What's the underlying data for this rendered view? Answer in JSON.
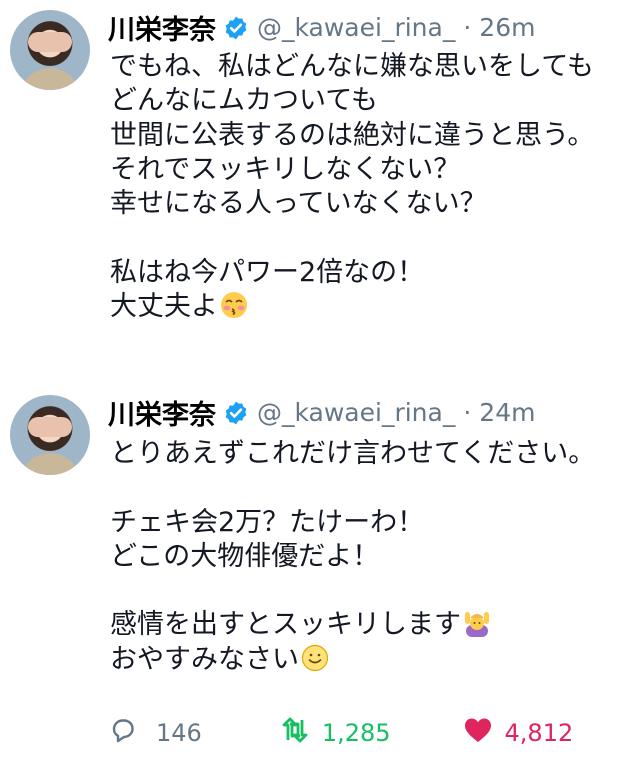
{
  "tweets": [
    {
      "name": "川栄李奈",
      "handle": "@_kawaei_rina_",
      "separator": "·",
      "time": "26m",
      "lines": [
        "でもね、私はどんなに嫌な思いをしても",
        "どんなにムカついても",
        "世間に公表するのは絶対に違うと思う。",
        "それでスッキリしなくない？",
        "幸せになる人っていなくない？",
        "",
        "私はね今パワー2倍なの！",
        "大丈夫よ"
      ],
      "emoji": "kissing-face-icon"
    },
    {
      "name": "川栄李奈",
      "handle": "@_kawaei_rina_",
      "separator": "·",
      "time": "24m",
      "lines": [
        "とりあえずこれだけ言わせてください。",
        "",
        "チェキ会2万？たけーわ！",
        "どこの大物俳優だよ！",
        "",
        "感情を出すとスッキリします",
        "おやすみなさい"
      ],
      "emoji": [
        "person-raising-hands-icon",
        "smiling-face-icon"
      ],
      "stats": {
        "replies": "146",
        "retweets": "1,285",
        "likes": "4,812"
      }
    }
  ],
  "colors": {
    "verified": "#1da1f2",
    "handle": "#657786",
    "retweet": "#17bf63",
    "like": "#e0245e"
  }
}
